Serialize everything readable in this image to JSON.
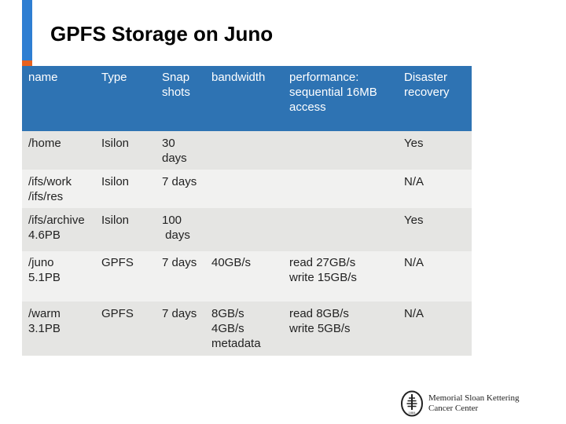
{
  "slide": {
    "title": "GPFS Storage on Juno",
    "colors": {
      "accent_blue": "#2e7ed2",
      "accent_orange": "#e8621e",
      "header_blue": "#2e73b3"
    }
  },
  "table": {
    "headers": [
      "name",
      "Type",
      "Snap\nshots",
      "bandwidth",
      "performance:\nsequential 16MB\naccess",
      "Disaster\nrecovery"
    ],
    "rows": [
      [
        "/home",
        "Isilon",
        "30\ndays",
        "",
        "",
        "Yes"
      ],
      [
        "/ifs/work\n/ifs/res",
        "Isilon",
        "7 days",
        "",
        "",
        "N/A"
      ],
      [
        "/ifs/archive\n4.6PB",
        "Isilon",
        "100\n days",
        "",
        "",
        "Yes"
      ],
      [
        "/juno\n5.1PB",
        "GPFS",
        "7 days",
        "40GB/s",
        "read 27GB/s\nwrite 15GB/s",
        "N/A"
      ],
      [
        "/warm\n3.1PB",
        "GPFS",
        "7 days",
        "8GB/s\n4GB/s\nmetadata",
        "read 8GB/s\nwrite 5GB/s",
        "N/A"
      ]
    ]
  },
  "logo": {
    "icon": "msk-tree-logo-icon",
    "line1": "Memorial Sloan Kettering",
    "line2": "Cancer Center",
    "year": "1884"
  }
}
